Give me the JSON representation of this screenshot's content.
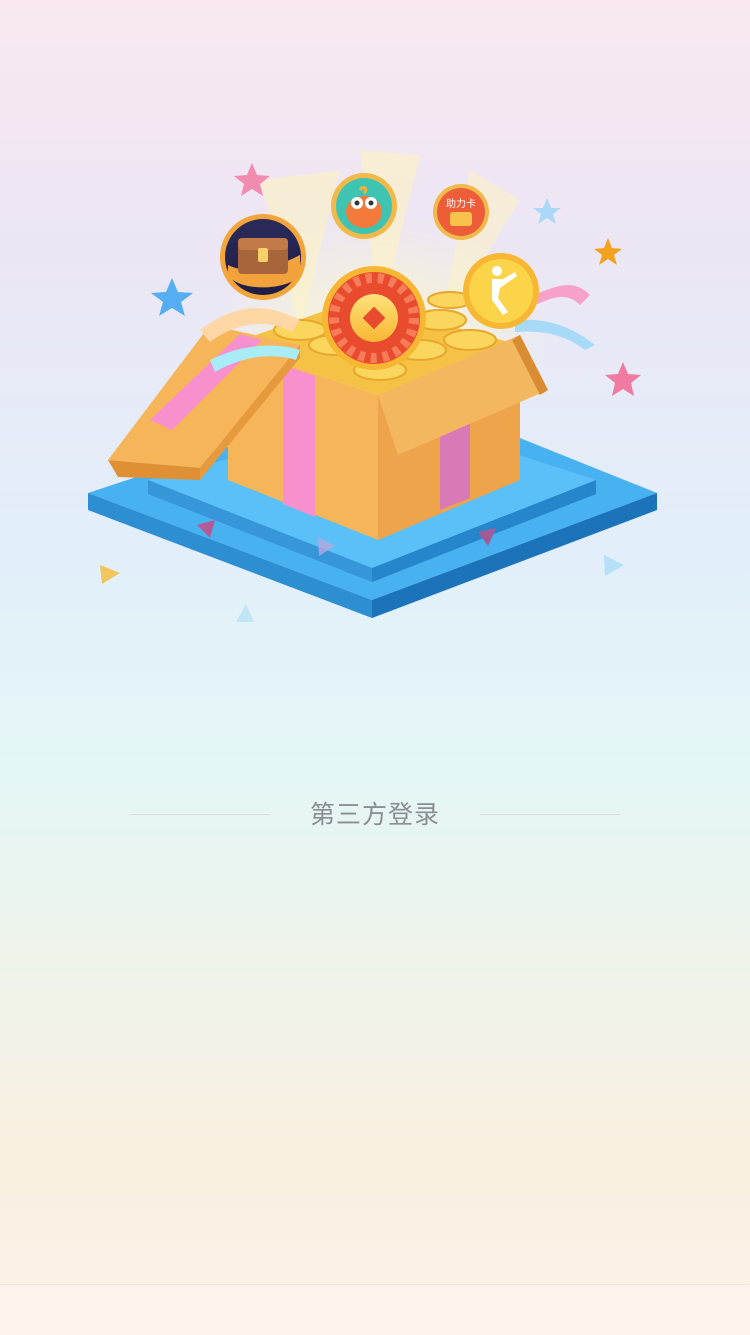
{
  "hero": {
    "badges": [
      {
        "id": "treasure-chest",
        "icon": "treasure-chest-icon"
      },
      {
        "id": "owl",
        "icon": "owl-icon"
      },
      {
        "id": "helper-card",
        "icon": "wallet-icon",
        "text": "助力卡"
      },
      {
        "id": "lucky-wheel",
        "icon": "lucky-wheel-icon"
      },
      {
        "id": "jump",
        "icon": "running-figure-icon"
      }
    ]
  },
  "login": {
    "divider_label": "第三方登录"
  },
  "colors": {
    "label": "#8a8e92",
    "divider": "#d9dde0",
    "box": "#f5b65b",
    "ribbon": "#f98fc8",
    "platform": "#3ea0e2"
  }
}
